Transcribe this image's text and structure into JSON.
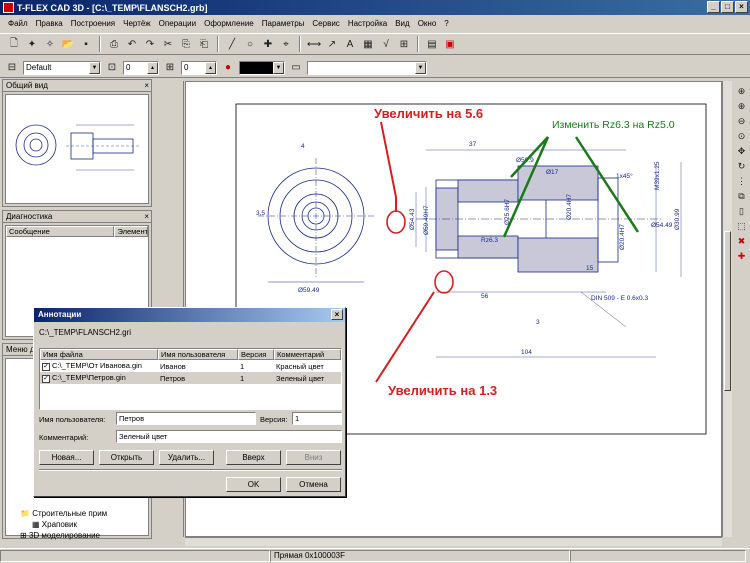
{
  "window": {
    "title": "T-FLEX CAD 3D - [C:\\_TEMP\\FLANSCH2.grb]"
  },
  "menu": [
    "Файл",
    "Правка",
    "Построения",
    "Чертёж",
    "Операции",
    "Оформление",
    "Параметры",
    "Сервис",
    "Настройка",
    "Вид",
    "Окно",
    "?"
  ],
  "propbar": {
    "style": "Default",
    "level1": "0",
    "level2": "0"
  },
  "panels": {
    "overview_title": "Общий вид",
    "diagnostics_title": "Диагностика",
    "diag_col1": "Сообщение",
    "diag_col2": "Элемент",
    "menu_title": "Меню д"
  },
  "tree": {
    "item1": "Строительные прим",
    "item2": "Храповик",
    "item3": "3D моделирование"
  },
  "drawing": {
    "dims": [
      "Ø59.49",
      "37",
      "Ø59.9",
      "Ø54.43",
      "Ø54.49",
      "Ø59.49H7",
      "Ø20.4H7",
      "Ø25.6H7",
      "Ø20.4H7",
      "Ø30.99",
      "M39x1.25",
      "1x45°",
      "Ø17",
      "Rz6.3",
      "56",
      "3",
      "104",
      "15",
      "3,5",
      "DIN 509 - E 0.6x0.3",
      "4"
    ]
  },
  "annotations": {
    "zoom1": "Увеличить на 5.6",
    "zoom2": "Увеличить на 1.3",
    "change": "Изменить Rz6.3 на Rz5.0"
  },
  "dialog": {
    "title": "Аннотации",
    "path": "C:\\_TEMP\\FLANSCH2.gri",
    "columns": [
      "Имя файла",
      "Имя пользователя",
      "Версия",
      "Комментарий"
    ],
    "rows": [
      {
        "file": "C:\\_TEMP\\От Иванова.gin",
        "user": "Иванов",
        "version": "1",
        "comment": "Красный цвет"
      },
      {
        "file": "C:\\_TEMP\\Петров.gin",
        "user": "Петров",
        "version": "1",
        "comment": "Зеленый цвет"
      }
    ],
    "user_label": "Имя пользователя:",
    "user_value": "Петров",
    "version_label": "Версия:",
    "version_value": "1",
    "comment_label": "Комментарий:",
    "comment_value": "Зеленый цвет",
    "btn_new": "Новая...",
    "btn_open": "Открыть",
    "btn_delete": "Удалить...",
    "btn_up": "Вверх",
    "btn_down": "Вниз",
    "btn_ok": "OK",
    "btn_cancel": "Отмена"
  },
  "status": {
    "text": "Прямая 0x100003F"
  },
  "colors": {
    "annot_red": "#d42020",
    "annot_green": "#1a7a1a",
    "drawing_blue": "#1a2a8a"
  }
}
